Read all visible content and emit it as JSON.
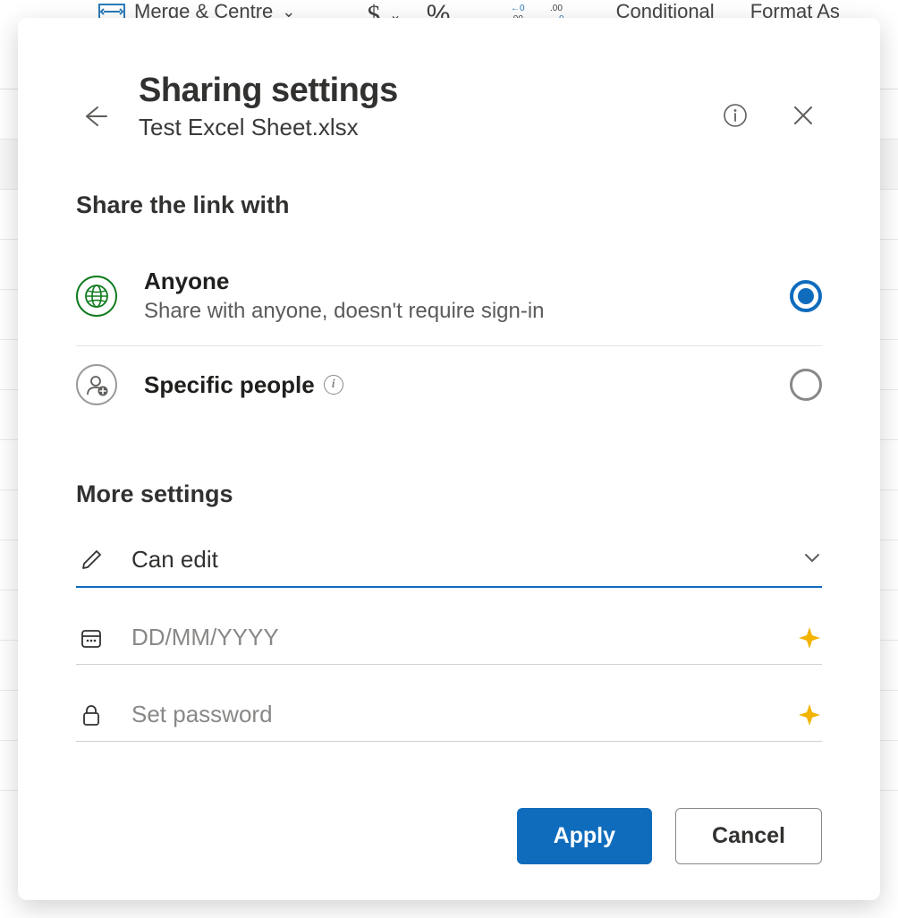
{
  "bg": {
    "merge_centre": "Merge & Centre",
    "conditional": "Conditional",
    "format_as": "Format As"
  },
  "header": {
    "title": "Sharing settings",
    "subtitle": "Test Excel Sheet.xlsx"
  },
  "share_section_heading": "Share the link with",
  "options": {
    "anyone": {
      "title": "Anyone",
      "desc": "Share with anyone, doesn't require sign-in",
      "selected": true
    },
    "specific": {
      "title": "Specific people",
      "selected": false
    }
  },
  "more_settings_heading": "More settings",
  "permission": {
    "label": "Can edit"
  },
  "expiry": {
    "placeholder": "DD/MM/YYYY"
  },
  "password": {
    "placeholder": "Set password"
  },
  "buttons": {
    "apply": "Apply",
    "cancel": "Cancel"
  }
}
